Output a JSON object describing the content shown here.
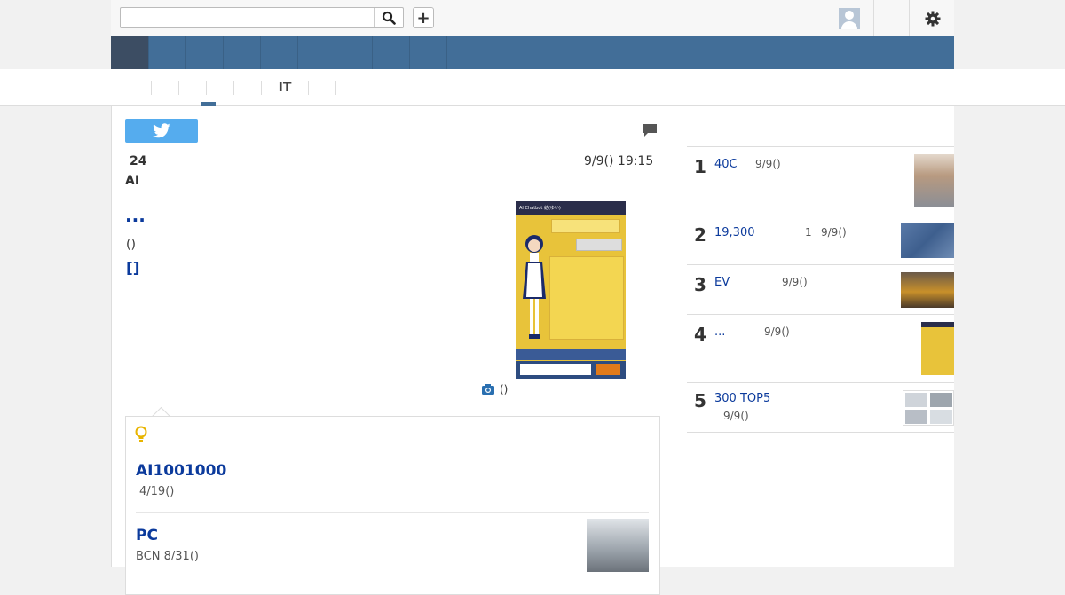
{
  "search": {
    "placeholder": "",
    "value": ""
  },
  "toolbar": {
    "plus_label": "+"
  },
  "subnav": {
    "items": [
      "",
      "",
      "",
      "",
      "",
      "IT",
      ""
    ]
  },
  "article": {
    "count": "24",
    "datetime": "9/9() 19:15",
    "category": "AI",
    "headline": "...",
    "source_paren": "()",
    "bracket_link": "[]",
    "photo_caption": "()",
    "photo_header": "AI Chatbot 結(ゆい)"
  },
  "related": {
    "items": [
      {
        "title": "AI1001000",
        "meta": "4/19()"
      },
      {
        "title": "PC",
        "meta": "BCN 8/31()"
      }
    ]
  },
  "ranking": {
    "items": [
      {
        "rank": "1",
        "title": "40C",
        "extra": "",
        "date": "9/9()"
      },
      {
        "rank": "2",
        "title": "19,300",
        "extra": "1",
        "date": "9/9()"
      },
      {
        "rank": "3",
        "title": "EV",
        "extra": "",
        "date": "9/9()"
      },
      {
        "rank": "4",
        "title": "...",
        "extra": "",
        "date": "9/9()"
      },
      {
        "rank": "5",
        "title": "300 TOP5",
        "extra": "",
        "date": "9/9()"
      }
    ]
  },
  "colors": {
    "nav": "#426e98",
    "link": "#0b3a9c",
    "twitter": "#55acee"
  }
}
